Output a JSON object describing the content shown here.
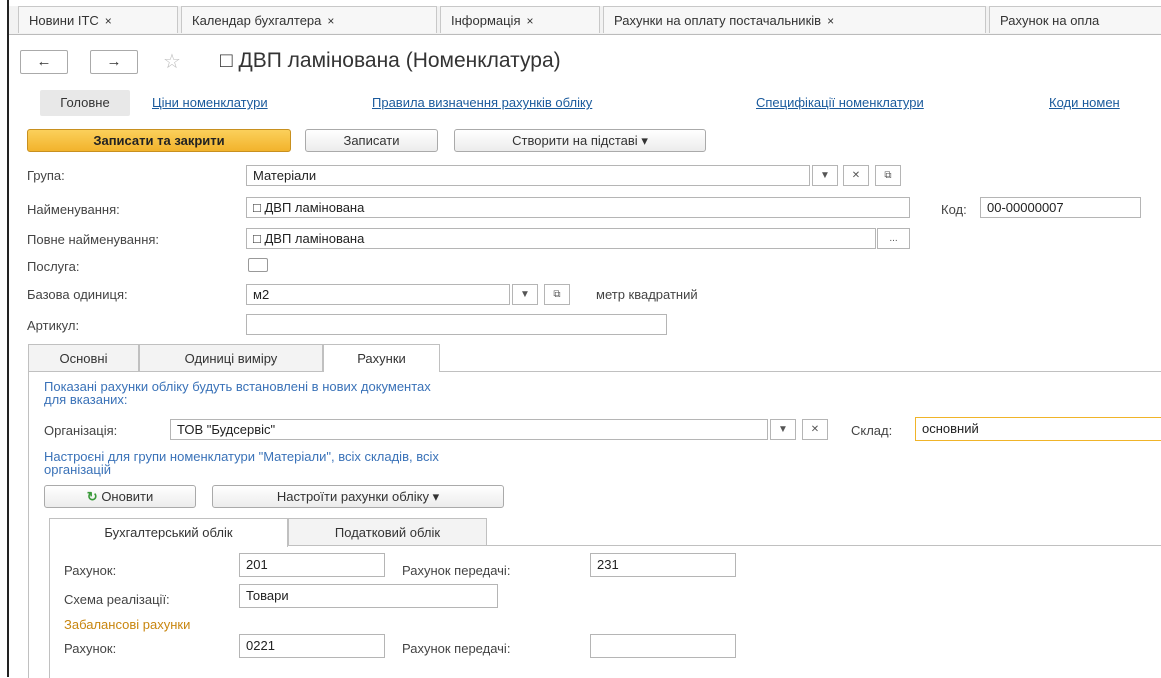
{
  "window_tabs": [
    {
      "label": "Новини ІТС",
      "close": "×"
    },
    {
      "label": "Календар бухгалтера",
      "close": "×"
    },
    {
      "label": "Інформація",
      "close": "×"
    },
    {
      "label": "Рахунки на оплату постачальників",
      "close": "×"
    },
    {
      "label": "Рахунок на опла"
    }
  ],
  "nav": {
    "back": "←",
    "forward": "→",
    "star": "☆"
  },
  "title": "□ ДВП ламінована (Номенклатура)",
  "links": {
    "home": "Головне",
    "items": [
      "Ціни номенклатури",
      "Правила визначення рахунків обліку",
      "Специфікації номенклатури",
      "Коди номен"
    ]
  },
  "toolbar": {
    "save_close": "Записати та закрити",
    "save": "Записати",
    "create_based": "Створити на підставі",
    "dropdown_arrow": "▾"
  },
  "form": {
    "group_label": "Група:",
    "group_value": "Матеріали",
    "name_label": "Найменування:",
    "name_value": "□ ДВП ламінована",
    "code_label": "Код:",
    "code_value": "00-00000007",
    "fullname_label": "Повне найменування:",
    "fullname_value": "□ ДВП ламінована",
    "service_label": "Послуга:",
    "unit_label": "Базова одиниця:",
    "unit_value": "м2",
    "unit_desc": "метр квадратний",
    "article_label": "Артикул:",
    "article_value": ""
  },
  "subtabs": [
    "Основні",
    "Одиниці виміру",
    "Рахунки"
  ],
  "accounts_tab": {
    "info1": "Показані рахунки обліку будуть встановлені в нових документах",
    "info1b": "для вказаних:",
    "org_label": "Організація:",
    "org_value": "ТОВ \"Будсервіс\"",
    "warehouse_label": "Склад:",
    "warehouse_value": "основний",
    "info2": "Настроєні для групи номенклатури \"Матеріали\", всіх складів, всіх",
    "info2b": "організацій",
    "refresh_label": "Оновити",
    "setup_label": "Настроїти рахунки обліку",
    "inner_tabs": [
      "Бухгалтерський облік",
      "Податковий облік"
    ],
    "account_label": "Рахунок:",
    "account_value": "201",
    "transfer_label": "Рахунок передачі:",
    "transfer_value": "231",
    "scheme_label": "Схема реалізації:",
    "scheme_value": "Товари",
    "offbalance_title": "Забалансові рахунки",
    "off_account_label": "Рахунок:",
    "off_account_value": "0221",
    "off_transfer_label": "Рахунок передачі:",
    "off_transfer_value": ""
  }
}
